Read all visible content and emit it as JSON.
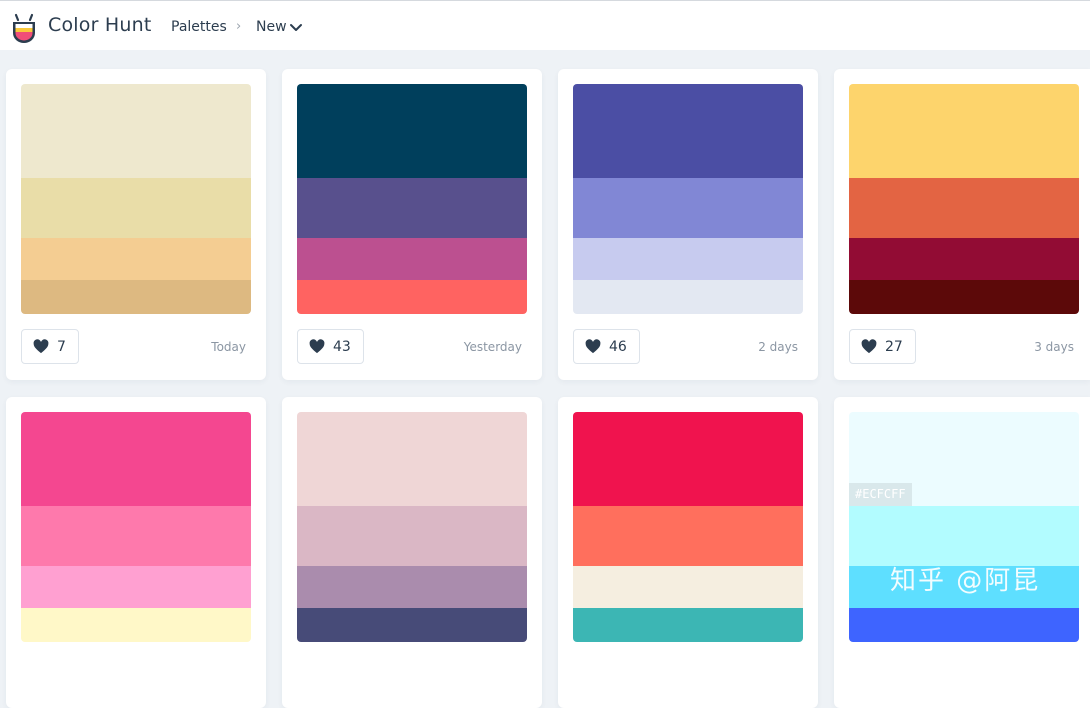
{
  "header": {
    "brand": "Color Hunt",
    "breadcrumb": {
      "palettes": "Palettes",
      "separator": "›",
      "current": "New"
    }
  },
  "palettes": [
    {
      "colors": [
        "#EEE8CE",
        "#E9DDA8",
        "#F4CD92",
        "#DDB981"
      ],
      "likes": "7",
      "date": "Today"
    },
    {
      "colors": [
        "#003F5C",
        "#58508D",
        "#BC5090",
        "#FF6361"
      ],
      "likes": "43",
      "date": "Yesterday"
    },
    {
      "colors": [
        "#4B4EA4",
        "#8187D5",
        "#C7CBEF",
        "#E3E8F2"
      ],
      "likes": "46",
      "date": "2 days"
    },
    {
      "colors": [
        "#FDD46C",
        "#E36443",
        "#920C34",
        "#5C0909"
      ],
      "likes": "27",
      "date": "3 days"
    },
    {
      "colors": [
        "#F44790",
        "#FE79AC",
        "#FFA0D1",
        "#FFF8C8"
      ]
    },
    {
      "colors": [
        "#EFD6D6",
        "#DAB7C5",
        "#AA8CAD",
        "#474B78"
      ]
    },
    {
      "colors": [
        "#F0134E",
        "#FF6F5D",
        "#F5EEE0",
        "#3CB6B4"
      ]
    },
    {
      "colors": [
        "#ECFCFF",
        "#B2FCFF",
        "#5EDFFF",
        "#3E64FF"
      ],
      "hover_hex": "#ECFCFF"
    }
  ],
  "watermark": "知乎 @阿昆",
  "icons": {
    "logo": "color-hunt-logo-icon",
    "like": "heart-icon",
    "dropdown": "chevron-down-icon"
  }
}
